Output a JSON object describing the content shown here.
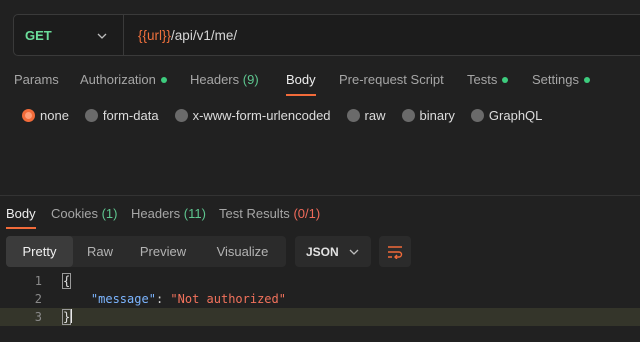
{
  "request": {
    "method": "GET",
    "url_variable": "{{url}}",
    "url_path": "/api/v1/me/"
  },
  "request_tabs": [
    {
      "label": "Params"
    },
    {
      "label": "Authorization"
    },
    {
      "label": "Headers",
      "count": "(9)"
    },
    {
      "label": "Body"
    },
    {
      "label": "Pre-request Script"
    },
    {
      "label": "Tests"
    },
    {
      "label": "Settings"
    }
  ],
  "body_options": [
    "none",
    "form-data",
    "x-www-form-urlencoded",
    "raw",
    "binary",
    "GraphQL"
  ],
  "response_tabs": [
    {
      "label": "Body"
    },
    {
      "label": "Cookies",
      "count": "(1)"
    },
    {
      "label": "Headers",
      "count": "(11)"
    },
    {
      "label": "Test Results",
      "count": "(0/1)"
    }
  ],
  "format_buttons": [
    "Pretty",
    "Raw",
    "Preview",
    "Visualize"
  ],
  "format_select": "JSON",
  "response_body": {
    "line_numbers": [
      "1",
      "2",
      "3"
    ],
    "open": "{",
    "key": "\"message\"",
    "colon": ": ",
    "value": "\"Not authorized\"",
    "close": "}"
  },
  "colors": {
    "accent": "#f26b3a",
    "green": "#3dcc7e",
    "method": "#6bdd9a"
  }
}
